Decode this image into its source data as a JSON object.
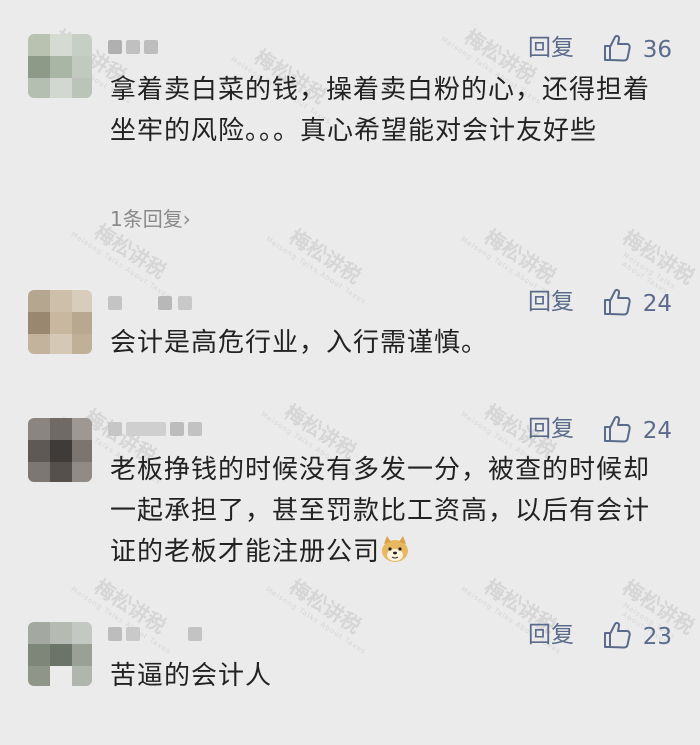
{
  "comments": [
    {
      "reply_label": "回复",
      "likes": "36",
      "text": "拿着卖白菜的钱，操着卖白粉的心，还得担着坐牢的风险。。。真心希望能对会计友好些",
      "replies_link": "1条回复",
      "name_visible": "·· ··"
    },
    {
      "reply_label": "回复",
      "likes": "24",
      "text": "会计是高危行业，入行需谨慎。",
      "name_visible": ""
    },
    {
      "reply_label": "回复",
      "likes": "24",
      "text": "老板挣钱的时候没有多发一分，被查的时候却一起承担了，甚至罚款比工资高，以后有会计证的老板才能注册公司",
      "emoji": "doge-emoji",
      "name_visible": ""
    },
    {
      "reply_label": "回复",
      "likes": "23",
      "text": "苦逼的会计人",
      "name_visible": ""
    }
  ],
  "watermark": {
    "text": "梅松讲税",
    "subtext": "Meisong Talks About Taxes"
  },
  "colors": {
    "background": "#ebebeb",
    "accent": "#5a6b8c",
    "text": "#222222",
    "muted": "#8a8a8a"
  },
  "icons": {
    "like": "thumbs-up-icon",
    "chevron": "chevron-right-icon"
  }
}
